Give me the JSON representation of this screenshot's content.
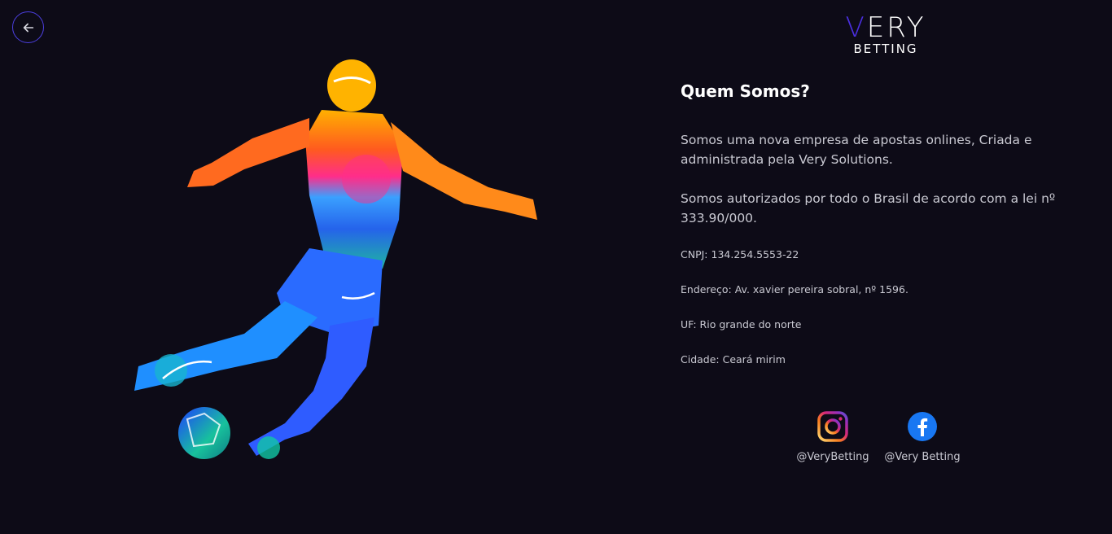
{
  "nav": {
    "back_icon": "arrow-left-icon"
  },
  "logo": {
    "very_v": "V",
    "very_rest": "ERY",
    "betting": "BETTING"
  },
  "about": {
    "title": "Quem Somos?",
    "paragraph1": "Somos uma nova empresa de apostas onlines, Criada e administrada pela Very Solutions.",
    "paragraph2": "Somos autorizados por todo o Brasil de acordo com a lei nº 333.90/000.",
    "cnpj": "CNPJ: 134.254.5553-22",
    "endereco": "Endereço: Av. xavier pereira sobral, nº 1596.",
    "uf": "UF: Rio grande do norte",
    "cidade": "Cidade: Ceará mirim"
  },
  "social": [
    {
      "network": "instagram",
      "icon": "instagram-icon",
      "handle": "@VeryBetting"
    },
    {
      "network": "facebook",
      "icon": "facebook-icon",
      "handle": "@Very Betting"
    }
  ],
  "colors": {
    "background": "#0d0b17",
    "accent": "#4a2fe0",
    "text": "#c9c9d2",
    "title": "#ffffff"
  }
}
